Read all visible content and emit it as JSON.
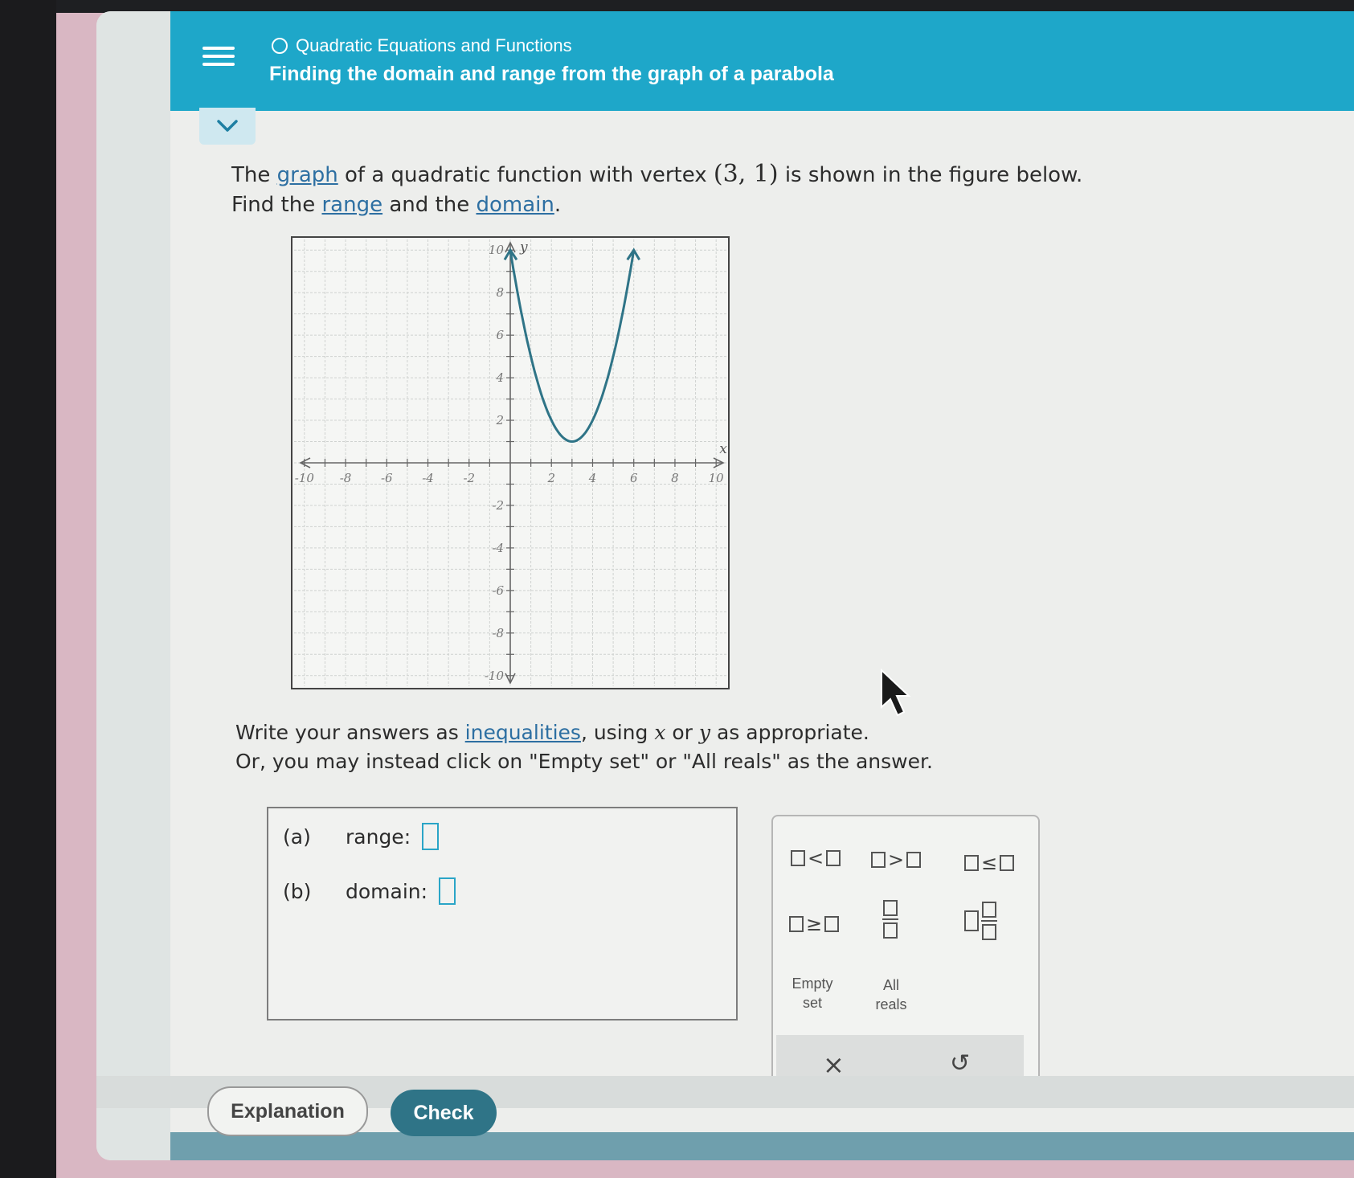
{
  "header": {
    "breadcrumb": "Quadratic Equations and Functions",
    "title": "Finding the domain and range from the graph of a parabola"
  },
  "question": {
    "p1": "The ",
    "link_graph": "graph",
    "p2": " of a quadratic function with vertex ",
    "vertex": "(3, 1)",
    "p3": " is shown in the figure below.",
    "p4": "Find the ",
    "link_range": "range",
    "p5": " and the ",
    "link_domain": "domain",
    "p6": "."
  },
  "chart_data": {
    "type": "line",
    "xlabel": "x",
    "ylabel": "y",
    "xlim": [
      -10,
      10
    ],
    "ylim": [
      -10,
      10
    ],
    "grid": true,
    "x_tick_labels": [
      "-10",
      "-8",
      "-6",
      "-4",
      "-2",
      "2",
      "4",
      "6",
      "8",
      "10"
    ],
    "y_tick_labels": [
      "10",
      "8",
      "6",
      "4",
      "2",
      "-2",
      "-4",
      "-6",
      "-8",
      "-10"
    ],
    "series": [
      {
        "vertex": [
          3,
          1
        ],
        "points": [
          [
            0,
            10
          ],
          [
            1,
            5
          ],
          [
            2,
            2
          ],
          [
            3,
            1
          ],
          [
            4,
            2
          ],
          [
            5,
            5
          ],
          [
            6,
            10
          ]
        ]
      }
    ]
  },
  "instructions": {
    "l1a": "Write your answers as ",
    "link_ineq": "inequalities",
    "l1b": ", using ",
    "x": "x",
    "l1c": " or ",
    "y": "y",
    "l1d": " as appropriate.",
    "l2": "Or, you may instead click on \"Empty set\" or \"All reals\" as the answer."
  },
  "answers": {
    "a_label": "(a)",
    "a_text": "range:",
    "b_label": "(b)",
    "b_text": "domain:"
  },
  "palette": {
    "lt": "<",
    "gt": ">",
    "le": "≤",
    "ge": "≥",
    "empty_1": "Empty",
    "empty_2": "set",
    "allreals_1": "All",
    "allreals_2": "reals",
    "clear": "×",
    "undo": "↺"
  },
  "buttons": {
    "explanation": "Explanation",
    "check": "Check"
  }
}
